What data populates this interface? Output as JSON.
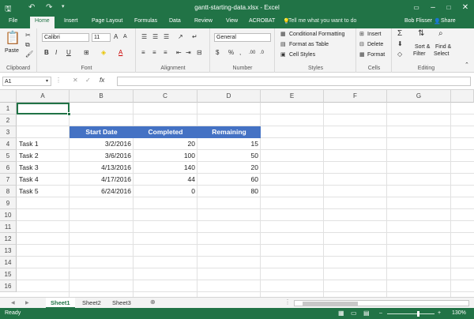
{
  "window": {
    "title": "gantt-starting-data.xlsx - Excel"
  },
  "tabs": [
    "File",
    "Home",
    "Insert",
    "Page Layout",
    "Formulas",
    "Data",
    "Review",
    "View",
    "ACROBAT"
  ],
  "tell_me": "Tell me what you want to do",
  "user": "Bob Flisser",
  "share": "Share",
  "ribbon": {
    "clipboard": {
      "paste": "Paste",
      "label": "Clipboard"
    },
    "font": {
      "name": "Calibri",
      "size": "11",
      "label": "Font"
    },
    "alignment": {
      "label": "Alignment"
    },
    "number": {
      "format": "General",
      "label": "Number"
    },
    "styles": {
      "conditional": "Conditional Formatting",
      "table": "Format as Table",
      "cell": "Cell Styles",
      "label": "Styles"
    },
    "cells": {
      "insert": "Insert",
      "delete": "Delete",
      "format": "Format",
      "label": "Cells"
    },
    "editing": {
      "sort": "Sort &",
      "filter": "Filter",
      "find": "Find &",
      "select": "Select",
      "label": "Editing"
    }
  },
  "formula_bar": {
    "name_box": "A1",
    "fx": "fx",
    "value": ""
  },
  "columns": [
    "A",
    "B",
    "C",
    "D",
    "E",
    "F",
    "G"
  ],
  "rows": [
    "1",
    "2",
    "3",
    "4",
    "5",
    "6",
    "7",
    "8",
    "9",
    "10",
    "11",
    "12",
    "13",
    "14",
    "15",
    "16"
  ],
  "table": {
    "headers": [
      "Start Date",
      "Completed",
      "Remaining"
    ],
    "rows": [
      [
        "Task 1",
        "3/2/2016",
        "20",
        "15"
      ],
      [
        "Task 2",
        "3/6/2016",
        "100",
        "50"
      ],
      [
        "Task 3",
        "4/13/2016",
        "140",
        "20"
      ],
      [
        "Task 4",
        "4/17/2016",
        "44",
        "60"
      ],
      [
        "Task 5",
        "6/24/2016",
        "0",
        "80"
      ]
    ]
  },
  "sheets": [
    "Sheet1",
    "Sheet2",
    "Sheet3"
  ],
  "status": {
    "ready": "Ready",
    "zoom": "130%"
  },
  "colors": {
    "excel_green": "#217346",
    "table_header": "#4472c4"
  }
}
